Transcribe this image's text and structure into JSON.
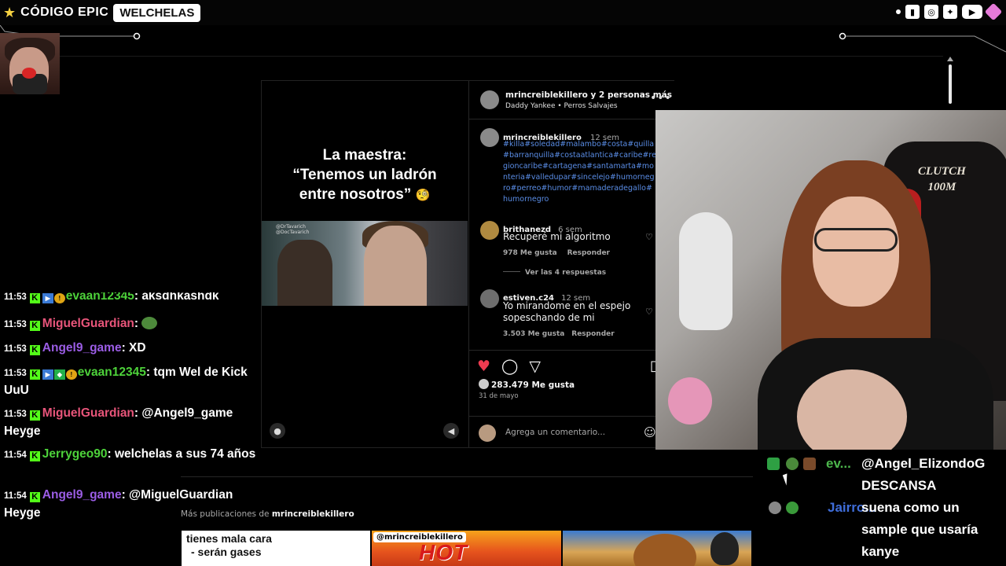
{
  "overlay": {
    "brand_left": "CÓDIGO EPIC",
    "brand_pill": "WELCHELAS",
    "social_icons": [
      "twitch-icon",
      "instagram-icon",
      "twitter-icon",
      "youtube-icon",
      "gem-icon"
    ]
  },
  "post": {
    "caption_line1": "La maestra:",
    "caption_line2": "“Tenemos un ladrón",
    "caption_line3": "entre nosotros”",
    "caption_emoji": "🧐",
    "video_watermark_1": "@DrTavarich",
    "video_watermark_2": "@DocTavarich",
    "header_name": "mrincreiblekillero y 2 personas más",
    "header_sub": "Daddy Yankee • Perros Salvajes",
    "author": {
      "name": "mrincreiblekillero",
      "time": "12 sem",
      "tags": "#killa#soledad#malambo#costa#quilla#barranquilla#costaatlantica#caribe#regioncaribe#cartagena#santamarta#monteria#valledupar#sincelejo#humornegro#perreo#humor#mamaderadegallo#humornegro"
    },
    "comments": [
      {
        "name": "brithanezd",
        "time": "6 sem",
        "text": "Recuperé mi algoritmo",
        "likes": "978 Me gusta",
        "reply": "Responder",
        "view_replies": "Ver las 4 respuestas"
      },
      {
        "name": "estiven.c24",
        "time": "12 sem",
        "text_line1": "Yo mirandome en el espejo",
        "text_line2": "sopeschando de mi",
        "likes": "3.503 Me gusta",
        "reply": "Responder"
      }
    ],
    "likes_total": "283.479 Me gusta",
    "date": "31 de mayo",
    "add_comment_placeholder": "Agrega un comentario...",
    "more_posts_prefix": "Más publicaciones de ",
    "more_posts_user": "mrincreiblekillero",
    "thumb1_line1": "tienes mala cara",
    "thumb1_line2": "- serán gases",
    "thumb2_tag": "@mrincreiblekillero",
    "thumb2_text": "HOT WHEELS"
  },
  "webcam": {
    "chair_text_1": "CLUTCH",
    "chair_text_2": "100M"
  },
  "chat": {
    "messages": [
      {
        "time": "11:53",
        "user": "evaan12345",
        "color": "#4dd23a",
        "text": "aksdhkashdk"
      },
      {
        "time": "11:53",
        "user": "MiguelGuardian",
        "color": "#e8557a",
        "text": ""
      },
      {
        "time": "11:53",
        "user": "Angel9_game",
        "color": "#9b5de5",
        "text": "XD"
      },
      {
        "time": "11:53",
        "user": "evaan12345",
        "color": "#4dd23a",
        "text": "tqm Wel de Kick UuU"
      },
      {
        "time": "11:53",
        "user": "MiguelGuardian",
        "color": "#e8557a",
        "text": "@Angel9_game Heyge"
      },
      {
        "time": "11:54",
        "user": "Jerrygeo90",
        "color": "#4dd23a",
        "text": "welchelas a sus 74 años"
      },
      {
        "time": "11:54",
        "user": "Angel9_game",
        "color": "#9b5de5",
        "text": "@MiguelGuardian Heyge"
      }
    ],
    "separator": ": "
  },
  "right_chat": {
    "messages": [
      {
        "user": "ev...",
        "line1": "@Angel_ElizondoG",
        "line2": "DESCANSA"
      },
      {
        "user": "Jairro...",
        "line1": "suena como un",
        "line2": "sample que usaría",
        "line3": "kanye"
      }
    ]
  }
}
